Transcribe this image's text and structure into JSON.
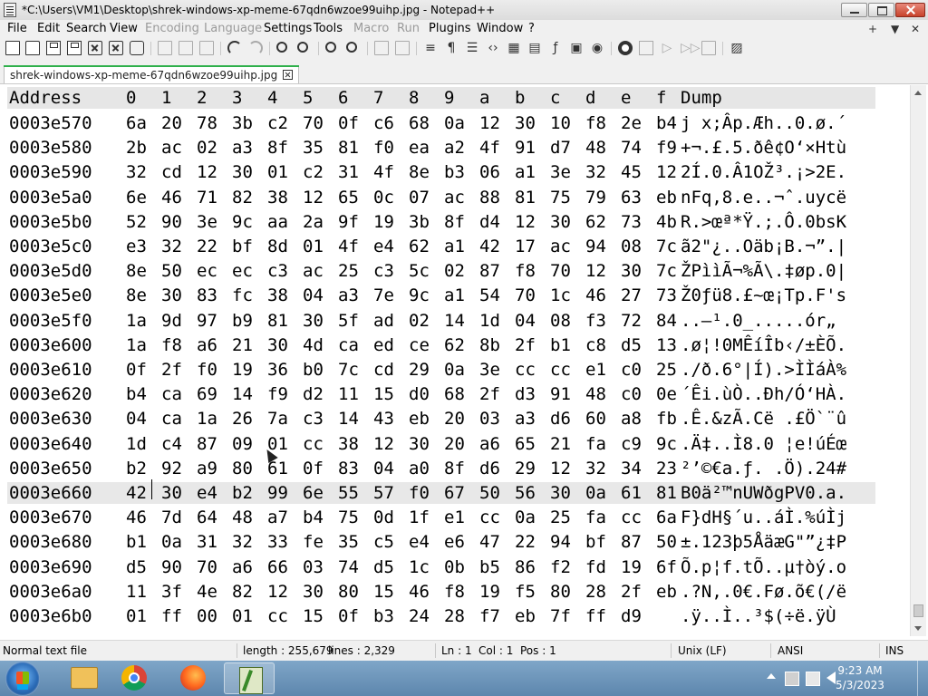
{
  "window": {
    "title": "*C:\\Users\\VM1\\Desktop\\shrek-windows-xp-meme-67qdn6wzoe99uihp.jpg - Notepad++"
  },
  "menu": {
    "items": [
      "File",
      "Edit",
      "Search",
      "View",
      "Encoding",
      "Language",
      "Settings",
      "Tools",
      "Macro",
      "Run",
      "Plugins",
      "Window",
      "?"
    ],
    "right": [
      "+",
      "▼",
      "✕"
    ]
  },
  "tab": {
    "label": "shrek-windows-xp-meme-67qdn6wzoe99uihp.jpg"
  },
  "toolbar": {
    "icons": [
      "new-file",
      "open-folder",
      "save",
      "save-all",
      "close",
      "close-all",
      "print",
      "cut",
      "copy",
      "paste",
      "undo",
      "redo",
      "find",
      "replace",
      "zoom-in",
      "zoom-out",
      "sync-vertical",
      "sync-horizontal",
      "word-wrap",
      "show-all-chars",
      "indent-guide",
      "udl",
      "document-map",
      "function-list",
      "folder-as-workspace",
      "monitoring",
      "record-macro",
      "stop-recording",
      "playback",
      "run-multiple",
      "save-macro",
      "trim"
    ]
  },
  "hex_view": {
    "headers": [
      "Address",
      "0",
      "1",
      "2",
      "3",
      "4",
      "5",
      "6",
      "7",
      "8",
      "9",
      "a",
      "b",
      "c",
      "d",
      "e",
      "f",
      "Dump"
    ],
    "rows": [
      {
        "addr": "0003e570",
        "bytes": [
          "6a",
          "20",
          "78",
          "3b",
          "c2",
          "70",
          "0f",
          "c6",
          "68",
          "0a",
          "12",
          "30",
          "10",
          "f8",
          "2e",
          "b4"
        ],
        "dump": "j x;Âp.Æh..0.ø.´"
      },
      {
        "addr": "0003e580",
        "bytes": [
          "2b",
          "ac",
          "02",
          "a3",
          "8f",
          "35",
          "81",
          "f0",
          "ea",
          "a2",
          "4f",
          "91",
          "d7",
          "48",
          "74",
          "f9"
        ],
        "dump": "+¬.£.5.ðê¢O‘×Htù"
      },
      {
        "addr": "0003e590",
        "bytes": [
          "32",
          "cd",
          "12",
          "30",
          "01",
          "c2",
          "31",
          "4f",
          "8e",
          "b3",
          "06",
          "a1",
          "3e",
          "32",
          "45",
          "12"
        ],
        "dump": "2Í.0.Â1OŽ³.¡>2E."
      },
      {
        "addr": "0003e5a0",
        "bytes": [
          "6e",
          "46",
          "71",
          "82",
          "38",
          "12",
          "65",
          "0c",
          "07",
          "ac",
          "88",
          "81",
          "75",
          "79",
          "63",
          "eb"
        ],
        "dump": "nFq‚8.e..¬ˆ.uycë"
      },
      {
        "addr": "0003e5b0",
        "bytes": [
          "52",
          "90",
          "3e",
          "9c",
          "aa",
          "2a",
          "9f",
          "19",
          "3b",
          "8f",
          "d4",
          "12",
          "30",
          "62",
          "73",
          "4b"
        ],
        "dump": "R.>œª*Ÿ.;.Ô.0bsK"
      },
      {
        "addr": "0003e5c0",
        "bytes": [
          "e3",
          "32",
          "22",
          "bf",
          "8d",
          "01",
          "4f",
          "e4",
          "62",
          "a1",
          "42",
          "17",
          "ac",
          "94",
          "08",
          "7c"
        ],
        "dump": "ã2\"¿..Oäb¡B.¬”.|"
      },
      {
        "addr": "0003e5d0",
        "bytes": [
          "8e",
          "50",
          "ec",
          "ec",
          "c3",
          "ac",
          "25",
          "c3",
          "5c",
          "02",
          "87",
          "f8",
          "70",
          "12",
          "30",
          "7c"
        ],
        "dump": "ŽPììÃ¬%Ã\\.‡øp.0|"
      },
      {
        "addr": "0003e5e0",
        "bytes": [
          "8e",
          "30",
          "83",
          "fc",
          "38",
          "04",
          "a3",
          "7e",
          "9c",
          "a1",
          "54",
          "70",
          "1c",
          "46",
          "27",
          "73"
        ],
        "dump": "Ž0ƒü8.£~œ¡Tp.F's"
      },
      {
        "addr": "0003e5f0",
        "bytes": [
          "1a",
          "9d",
          "97",
          "b9",
          "81",
          "30",
          "5f",
          "ad",
          "02",
          "14",
          "1d",
          "04",
          "08",
          "f3",
          "72",
          "84"
        ],
        "dump": "..—¹.0_­.....ór„"
      },
      {
        "addr": "0003e600",
        "bytes": [
          "1a",
          "f8",
          "a6",
          "21",
          "30",
          "4d",
          "ca",
          "ed",
          "ce",
          "62",
          "8b",
          "2f",
          "b1",
          "c8",
          "d5",
          "13"
        ],
        "dump": ".ø¦!0MÊíÎb‹/±ÈÕ."
      },
      {
        "addr": "0003e610",
        "bytes": [
          "0f",
          "2f",
          "f0",
          "19",
          "36",
          "b0",
          "7c",
          "cd",
          "29",
          "0a",
          "3e",
          "cc",
          "cc",
          "e1",
          "c0",
          "25"
        ],
        "dump": "./ð.6°|Í).>ÌÌáÀ%"
      },
      {
        "addr": "0003e620",
        "bytes": [
          "b4",
          "ca",
          "69",
          "14",
          "f9",
          "d2",
          "11",
          "15",
          "d0",
          "68",
          "2f",
          "d3",
          "91",
          "48",
          "c0",
          "0e"
        ],
        "dump": "´Êi.ùÒ..Ðh/Ó‘HÀ."
      },
      {
        "addr": "0003e630",
        "bytes": [
          "04",
          "ca",
          "1a",
          "26",
          "7a",
          "c3",
          "14",
          "43",
          "eb",
          "20",
          "03",
          "a3",
          "d6",
          "60",
          "a8",
          "fb"
        ],
        "dump": ".Ê.&zÃ.Cë .£Ö`¨û"
      },
      {
        "addr": "0003e640",
        "bytes": [
          "1d",
          "c4",
          "87",
          "09",
          "01",
          "cc",
          "38",
          "12",
          "30",
          "20",
          "a6",
          "65",
          "21",
          "fa",
          "c9",
          "9c"
        ],
        "dump": ".Ä‡..Ì8.0 ¦e!úÉœ"
      },
      {
        "addr": "0003e650",
        "bytes": [
          "b2",
          "92",
          "a9",
          "80",
          "61",
          "0f",
          "83",
          "04",
          "a0",
          "8f",
          "d6",
          "29",
          "12",
          "32",
          "34",
          "23"
        ],
        "dump": "²’©€a.ƒ. .Ö).24#"
      },
      {
        "addr": "0003e660",
        "bytes": [
          "42",
          "30",
          "e4",
          "b2",
          "99",
          "6e",
          "55",
          "57",
          "f0",
          "67",
          "50",
          "56",
          "30",
          "0a",
          "61",
          "81"
        ],
        "dump": "B0ä²™nUWðgPV0.a."
      },
      {
        "addr": "0003e670",
        "bytes": [
          "46",
          "7d",
          "64",
          "48",
          "a7",
          "b4",
          "75",
          "0d",
          "1f",
          "e1",
          "cc",
          "0a",
          "25",
          "fa",
          "cc",
          "6a"
        ],
        "dump": "F}dH§´u..áÌ.%úÌj"
      },
      {
        "addr": "0003e680",
        "bytes": [
          "b1",
          "0a",
          "31",
          "32",
          "33",
          "fe",
          "35",
          "c5",
          "e4",
          "e6",
          "47",
          "22",
          "94",
          "bf",
          "87",
          "50"
        ],
        "dump": "±.123þ5ÅäæG\"”¿‡P"
      },
      {
        "addr": "0003e690",
        "bytes": [
          "d5",
          "90",
          "70",
          "a6",
          "66",
          "03",
          "74",
          "d5",
          "1c",
          "0b",
          "b5",
          "86",
          "f2",
          "fd",
          "19",
          "6f"
        ],
        "dump": "Õ.p¦f.tÕ..µ†òý.o"
      },
      {
        "addr": "0003e6a0",
        "bytes": [
          "11",
          "3f",
          "4e",
          "82",
          "12",
          "30",
          "80",
          "15",
          "46",
          "f8",
          "19",
          "f5",
          "80",
          "28",
          "2f",
          "eb"
        ],
        "dump": ".?N‚.0€.Fø.õ€(/ë"
      },
      {
        "addr": "0003e6b0",
        "bytes": [
          "01",
          "ff",
          "00",
          "01",
          "cc",
          "15",
          "0f",
          "b3",
          "24",
          "28",
          "f7",
          "eb",
          "7f",
          "ff",
          "d9",
          ""
        ],
        "dump": ".ÿ..Ì..³$(÷ë.ÿÙ"
      }
    ]
  },
  "status": {
    "type": "Normal text file",
    "length": "length : 255,679",
    "lines": "lines : 2,329",
    "ln": "Ln : 1",
    "col": "Col : 1",
    "pos": "Pos : 1",
    "eol": "Unix (LF)",
    "encoding": "ANSI",
    "mode": "INS"
  },
  "taskbar": {
    "apps": [
      "Windows Explorer",
      "Google Chrome",
      "Firefox",
      "Notepad++"
    ],
    "time": "9:23 AM",
    "date": "5/3/2023"
  }
}
